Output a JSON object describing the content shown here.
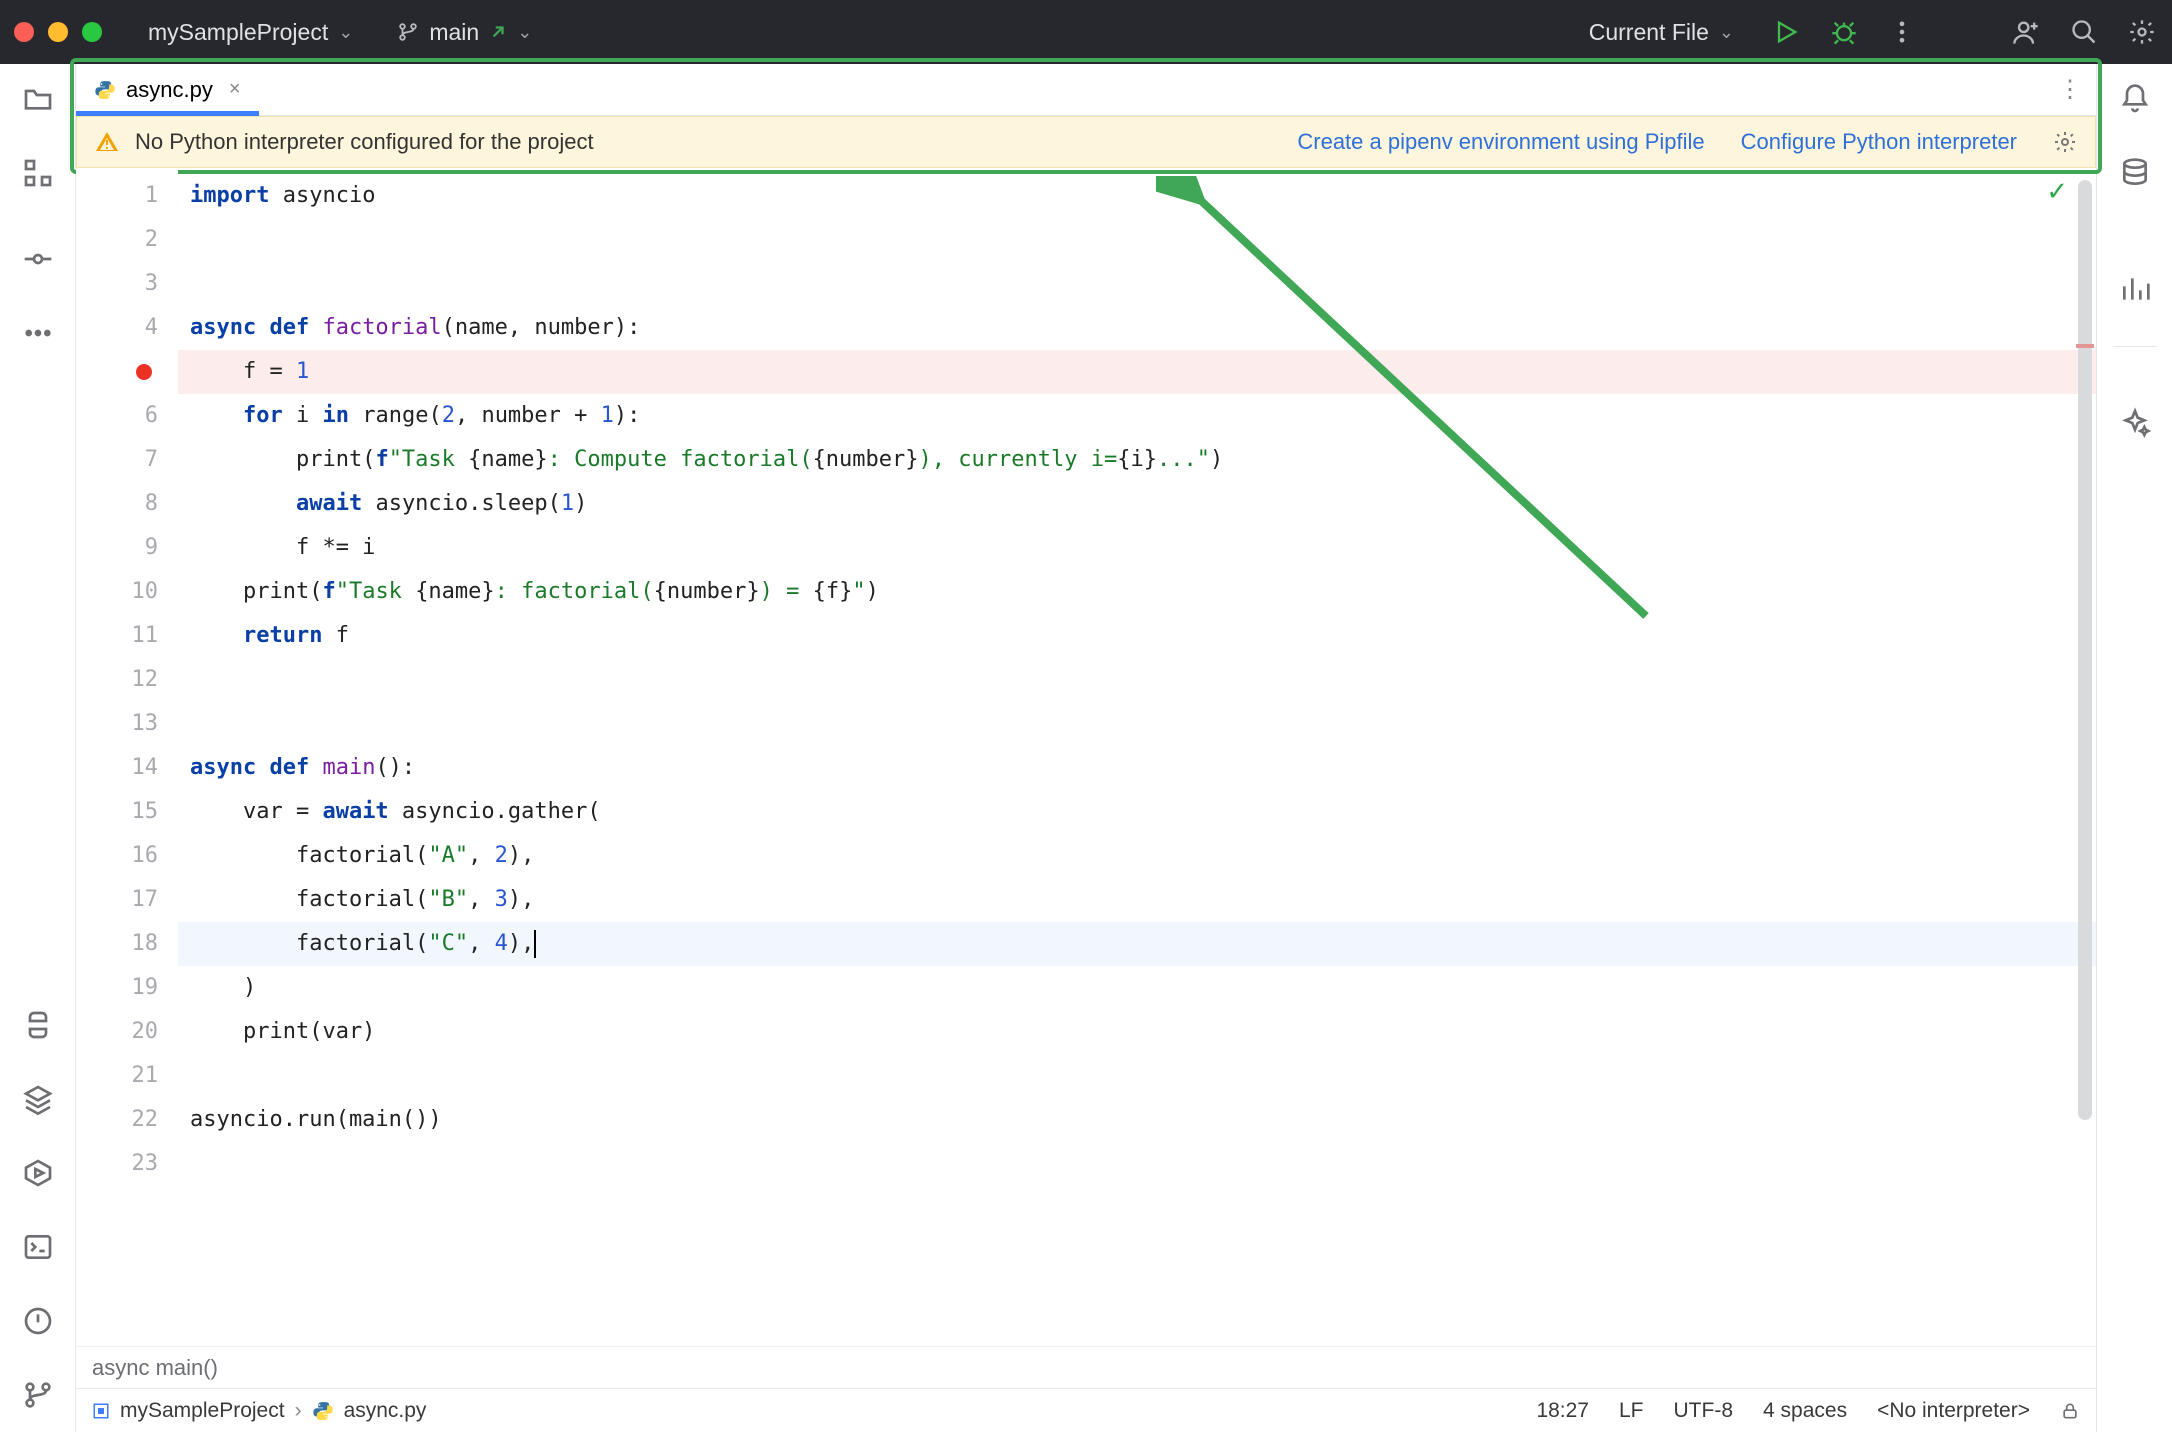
{
  "titlebar": {
    "project_name": "mySampleProject",
    "branch_name": "main",
    "run_config": "Current File"
  },
  "tabs": {
    "active": {
      "filename": "async.py"
    }
  },
  "banner": {
    "message": "No Python interpreter configured for the project",
    "link_pipenv": "Create a pipenv environment using Pipfile",
    "link_configure": "Configure Python interpreter"
  },
  "code_lines": [
    {
      "n": 1,
      "tokens": [
        [
          "kw",
          "import"
        ],
        [
          "op",
          " asyncio"
        ]
      ]
    },
    {
      "n": 2,
      "tokens": []
    },
    {
      "n": 3,
      "tokens": []
    },
    {
      "n": 4,
      "tokens": [
        [
          "kw",
          "async def "
        ],
        [
          "fn",
          "factorial"
        ],
        [
          "op",
          "(name, number):"
        ]
      ]
    },
    {
      "n": 5,
      "bp": true,
      "tokens": [
        [
          "op",
          "    f = "
        ],
        [
          "num",
          "1"
        ]
      ]
    },
    {
      "n": 6,
      "tokens": [
        [
          "op",
          "    "
        ],
        [
          "kw",
          "for"
        ],
        [
          "op",
          " i "
        ],
        [
          "kw",
          "in"
        ],
        [
          "op",
          " range("
        ],
        [
          "num",
          "2"
        ],
        [
          "op",
          ", number + "
        ],
        [
          "num",
          "1"
        ],
        [
          "op",
          "):"
        ]
      ]
    },
    {
      "n": 7,
      "tokens": [
        [
          "op",
          "        print("
        ],
        [
          "kw",
          "f"
        ],
        [
          "str",
          "\"Task "
        ],
        [
          "op",
          "{name}"
        ],
        [
          "str",
          ": Compute factorial("
        ],
        [
          "op",
          "{number}"
        ],
        [
          "str",
          "), currently i="
        ],
        [
          "op",
          "{i}"
        ],
        [
          "str",
          "...\""
        ],
        [
          "op",
          ")"
        ]
      ]
    },
    {
      "n": 8,
      "tokens": [
        [
          "op",
          "        "
        ],
        [
          "kw",
          "await"
        ],
        [
          "op",
          " asyncio.sleep("
        ],
        [
          "num",
          "1"
        ],
        [
          "op",
          ")"
        ]
      ]
    },
    {
      "n": 9,
      "tokens": [
        [
          "op",
          "        f *= i"
        ]
      ]
    },
    {
      "n": 10,
      "tokens": [
        [
          "op",
          "    print("
        ],
        [
          "kw",
          "f"
        ],
        [
          "str",
          "\"Task "
        ],
        [
          "op",
          "{name}"
        ],
        [
          "str",
          ": factorial("
        ],
        [
          "op",
          "{number}"
        ],
        [
          "str",
          ") = "
        ],
        [
          "op",
          "{f}"
        ],
        [
          "str",
          "\""
        ],
        [
          "op",
          ")"
        ]
      ]
    },
    {
      "n": 11,
      "tokens": [
        [
          "op",
          "    "
        ],
        [
          "kw",
          "return"
        ],
        [
          "op",
          " f"
        ]
      ]
    },
    {
      "n": 12,
      "tokens": []
    },
    {
      "n": 13,
      "tokens": []
    },
    {
      "n": 14,
      "tokens": [
        [
          "kw",
          "async def "
        ],
        [
          "fn",
          "main"
        ],
        [
          "op",
          "():"
        ]
      ]
    },
    {
      "n": 15,
      "tokens": [
        [
          "op",
          "    var = "
        ],
        [
          "kw",
          "await"
        ],
        [
          "op",
          " asyncio.gather("
        ]
      ]
    },
    {
      "n": 16,
      "tokens": [
        [
          "op",
          "        factorial("
        ],
        [
          "str",
          "\"A\""
        ],
        [
          "op",
          ", "
        ],
        [
          "num",
          "2"
        ],
        [
          "op",
          "),"
        ]
      ]
    },
    {
      "n": 17,
      "tokens": [
        [
          "op",
          "        factorial("
        ],
        [
          "str",
          "\"B\""
        ],
        [
          "op",
          ", "
        ],
        [
          "num",
          "3"
        ],
        [
          "op",
          "),"
        ]
      ]
    },
    {
      "n": 18,
      "cur": true,
      "caret": true,
      "tokens": [
        [
          "op",
          "        factorial("
        ],
        [
          "str",
          "\"C\""
        ],
        [
          "op",
          ", "
        ],
        [
          "num",
          "4"
        ],
        [
          "op",
          "),"
        ]
      ]
    },
    {
      "n": 19,
      "tokens": [
        [
          "op",
          "    )"
        ]
      ]
    },
    {
      "n": 20,
      "tokens": [
        [
          "op",
          "    print(var)"
        ]
      ]
    },
    {
      "n": 21,
      "tokens": []
    },
    {
      "n": 22,
      "tokens": [
        [
          "op",
          "asyncio.run(main())"
        ]
      ]
    },
    {
      "n": 23,
      "tokens": []
    }
  ],
  "inlay": "async main()",
  "breadcrumbs": {
    "project": "mySampleProject",
    "file": "async.py"
  },
  "status": {
    "position": "18:27",
    "line_sep": "LF",
    "encoding": "UTF-8",
    "indent": "4 spaces",
    "interpreter": "<No interpreter>"
  }
}
